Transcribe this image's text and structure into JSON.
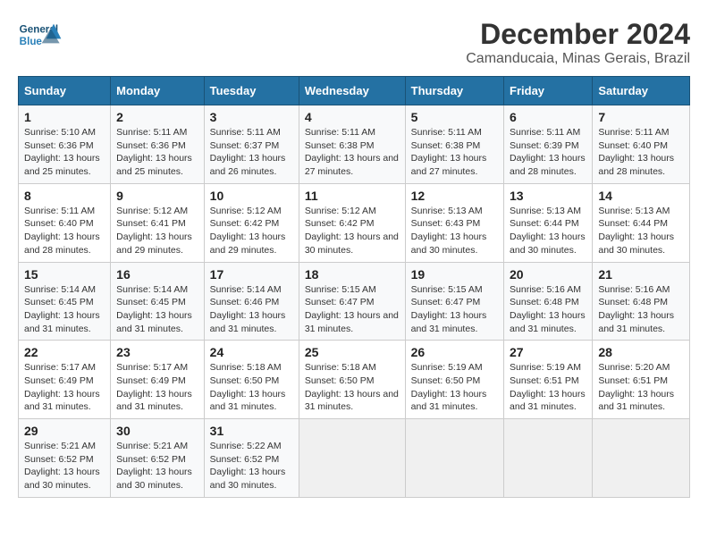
{
  "logo": {
    "general": "General",
    "blue": "Blue"
  },
  "title": "December 2024",
  "subtitle": "Camanducaia, Minas Gerais, Brazil",
  "days_of_week": [
    "Sunday",
    "Monday",
    "Tuesday",
    "Wednesday",
    "Thursday",
    "Friday",
    "Saturday"
  ],
  "weeks": [
    [
      {
        "num": "1",
        "sunrise": "5:10 AM",
        "sunset": "6:36 PM",
        "daylight": "13 hours and 25 minutes."
      },
      {
        "num": "2",
        "sunrise": "5:11 AM",
        "sunset": "6:36 PM",
        "daylight": "13 hours and 25 minutes."
      },
      {
        "num": "3",
        "sunrise": "5:11 AM",
        "sunset": "6:37 PM",
        "daylight": "13 hours and 26 minutes."
      },
      {
        "num": "4",
        "sunrise": "5:11 AM",
        "sunset": "6:38 PM",
        "daylight": "13 hours and 27 minutes."
      },
      {
        "num": "5",
        "sunrise": "5:11 AM",
        "sunset": "6:38 PM",
        "daylight": "13 hours and 27 minutes."
      },
      {
        "num": "6",
        "sunrise": "5:11 AM",
        "sunset": "6:39 PM",
        "daylight": "13 hours and 28 minutes."
      },
      {
        "num": "7",
        "sunrise": "5:11 AM",
        "sunset": "6:40 PM",
        "daylight": "13 hours and 28 minutes."
      }
    ],
    [
      {
        "num": "8",
        "sunrise": "5:11 AM",
        "sunset": "6:40 PM",
        "daylight": "13 hours and 28 minutes."
      },
      {
        "num": "9",
        "sunrise": "5:12 AM",
        "sunset": "6:41 PM",
        "daylight": "13 hours and 29 minutes."
      },
      {
        "num": "10",
        "sunrise": "5:12 AM",
        "sunset": "6:42 PM",
        "daylight": "13 hours and 29 minutes."
      },
      {
        "num": "11",
        "sunrise": "5:12 AM",
        "sunset": "6:42 PM",
        "daylight": "13 hours and 30 minutes."
      },
      {
        "num": "12",
        "sunrise": "5:13 AM",
        "sunset": "6:43 PM",
        "daylight": "13 hours and 30 minutes."
      },
      {
        "num": "13",
        "sunrise": "5:13 AM",
        "sunset": "6:44 PM",
        "daylight": "13 hours and 30 minutes."
      },
      {
        "num": "14",
        "sunrise": "5:13 AM",
        "sunset": "6:44 PM",
        "daylight": "13 hours and 30 minutes."
      }
    ],
    [
      {
        "num": "15",
        "sunrise": "5:14 AM",
        "sunset": "6:45 PM",
        "daylight": "13 hours and 31 minutes."
      },
      {
        "num": "16",
        "sunrise": "5:14 AM",
        "sunset": "6:45 PM",
        "daylight": "13 hours and 31 minutes."
      },
      {
        "num": "17",
        "sunrise": "5:14 AM",
        "sunset": "6:46 PM",
        "daylight": "13 hours and 31 minutes."
      },
      {
        "num": "18",
        "sunrise": "5:15 AM",
        "sunset": "6:47 PM",
        "daylight": "13 hours and 31 minutes."
      },
      {
        "num": "19",
        "sunrise": "5:15 AM",
        "sunset": "6:47 PM",
        "daylight": "13 hours and 31 minutes."
      },
      {
        "num": "20",
        "sunrise": "5:16 AM",
        "sunset": "6:48 PM",
        "daylight": "13 hours and 31 minutes."
      },
      {
        "num": "21",
        "sunrise": "5:16 AM",
        "sunset": "6:48 PM",
        "daylight": "13 hours and 31 minutes."
      }
    ],
    [
      {
        "num": "22",
        "sunrise": "5:17 AM",
        "sunset": "6:49 PM",
        "daylight": "13 hours and 31 minutes."
      },
      {
        "num": "23",
        "sunrise": "5:17 AM",
        "sunset": "6:49 PM",
        "daylight": "13 hours and 31 minutes."
      },
      {
        "num": "24",
        "sunrise": "5:18 AM",
        "sunset": "6:50 PM",
        "daylight": "13 hours and 31 minutes."
      },
      {
        "num": "25",
        "sunrise": "5:18 AM",
        "sunset": "6:50 PM",
        "daylight": "13 hours and 31 minutes."
      },
      {
        "num": "26",
        "sunrise": "5:19 AM",
        "sunset": "6:50 PM",
        "daylight": "13 hours and 31 minutes."
      },
      {
        "num": "27",
        "sunrise": "5:19 AM",
        "sunset": "6:51 PM",
        "daylight": "13 hours and 31 minutes."
      },
      {
        "num": "28",
        "sunrise": "5:20 AM",
        "sunset": "6:51 PM",
        "daylight": "13 hours and 31 minutes."
      }
    ],
    [
      {
        "num": "29",
        "sunrise": "5:21 AM",
        "sunset": "6:52 PM",
        "daylight": "13 hours and 30 minutes."
      },
      {
        "num": "30",
        "sunrise": "5:21 AM",
        "sunset": "6:52 PM",
        "daylight": "13 hours and 30 minutes."
      },
      {
        "num": "31",
        "sunrise": "5:22 AM",
        "sunset": "6:52 PM",
        "daylight": "13 hours and 30 minutes."
      },
      null,
      null,
      null,
      null
    ]
  ]
}
